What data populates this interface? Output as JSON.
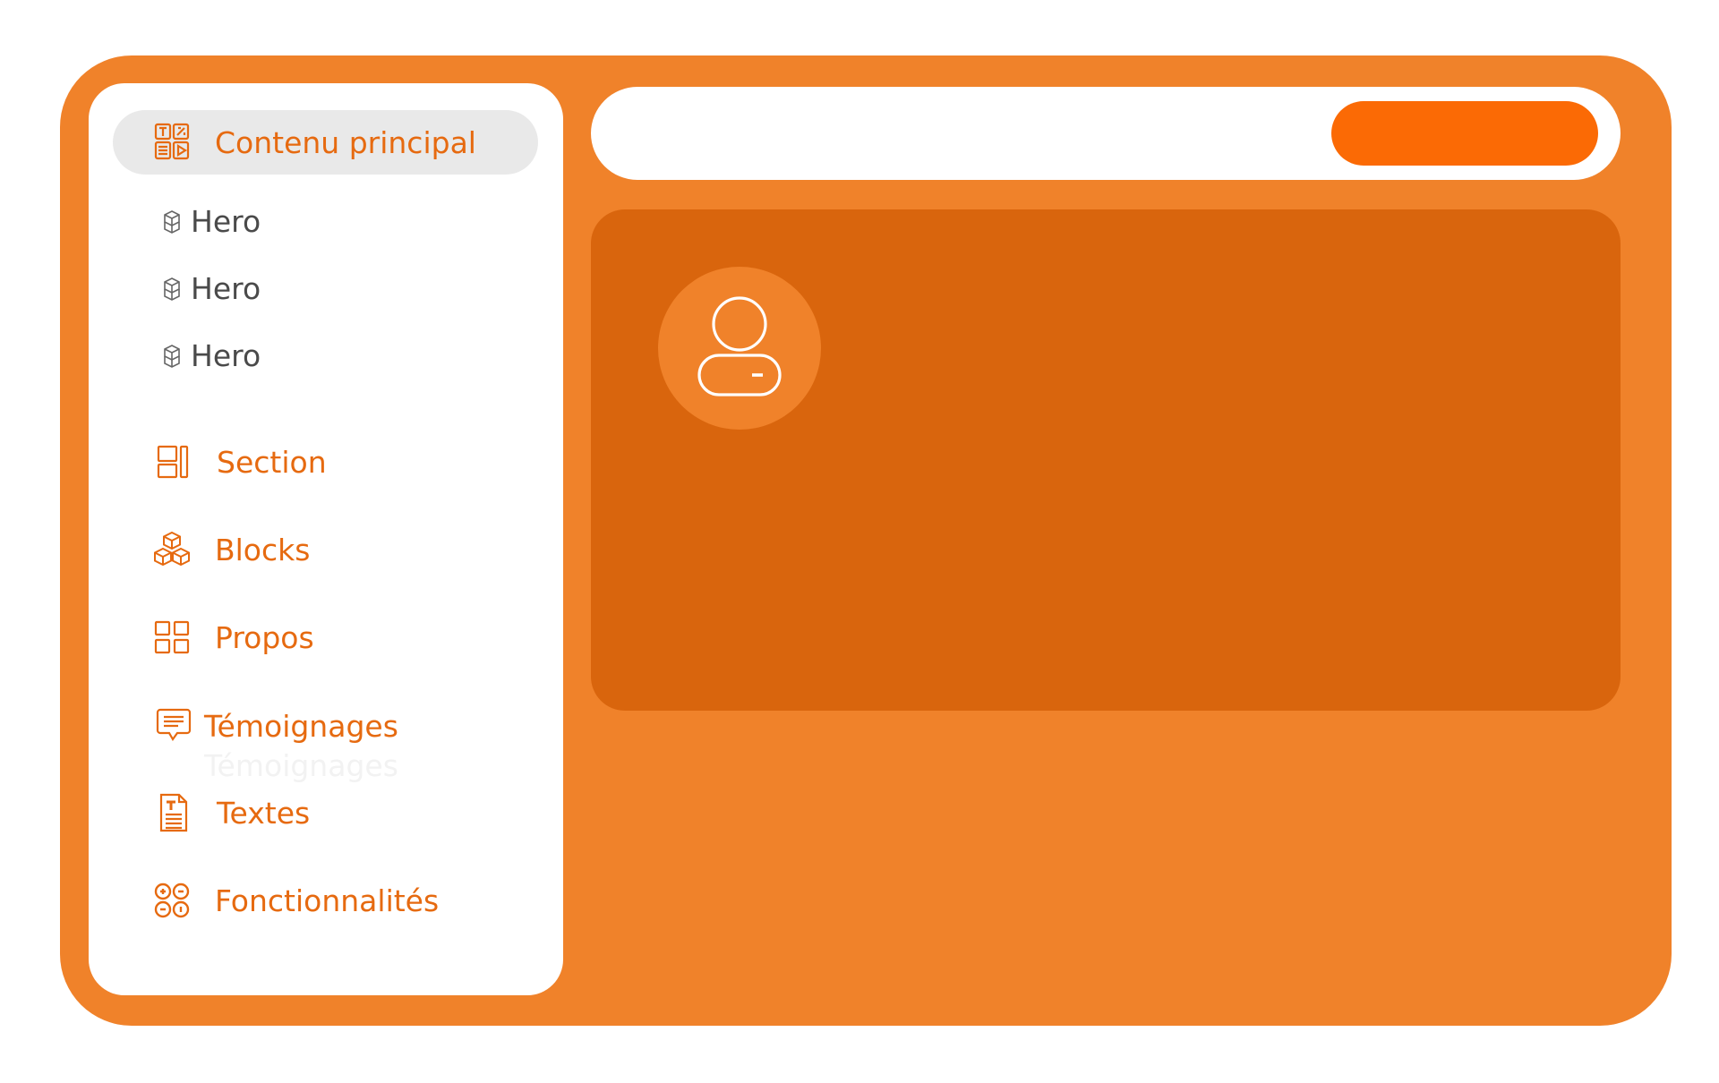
{
  "sidebar": {
    "active_item": {
      "label": "Contenu principal",
      "icon": "content-grid-icon"
    },
    "sub_items": [
      {
        "label": "Hero",
        "icon": "cube-icon"
      },
      {
        "label": "Hero",
        "icon": "cube-icon"
      },
      {
        "label": "Hero",
        "icon": "cube-icon"
      }
    ],
    "items": [
      {
        "label": "Section",
        "icon": "section-layout-icon"
      },
      {
        "label": "Blocks",
        "icon": "blocks-icon"
      },
      {
        "label": "Propos",
        "icon": "four-squares-icon"
      },
      {
        "label": "Témoignages",
        "icon": "chat-bubble-icon"
      },
      {
        "label": "Textes",
        "icon": "document-icon"
      },
      {
        "label": "Fonctionnalités",
        "icon": "features-icon"
      }
    ],
    "ghost_label": "Témoignages"
  },
  "header": {
    "cta_label": ""
  },
  "main": {
    "avatar_icon": "user-avatar-icon"
  },
  "colors": {
    "frame": "#f0822a",
    "card": "#d9650d",
    "accent": "#fb6a05",
    "text_accent": "#e66a10",
    "text_muted": "#4a4a4a",
    "active_bg": "#e9e9e9"
  }
}
